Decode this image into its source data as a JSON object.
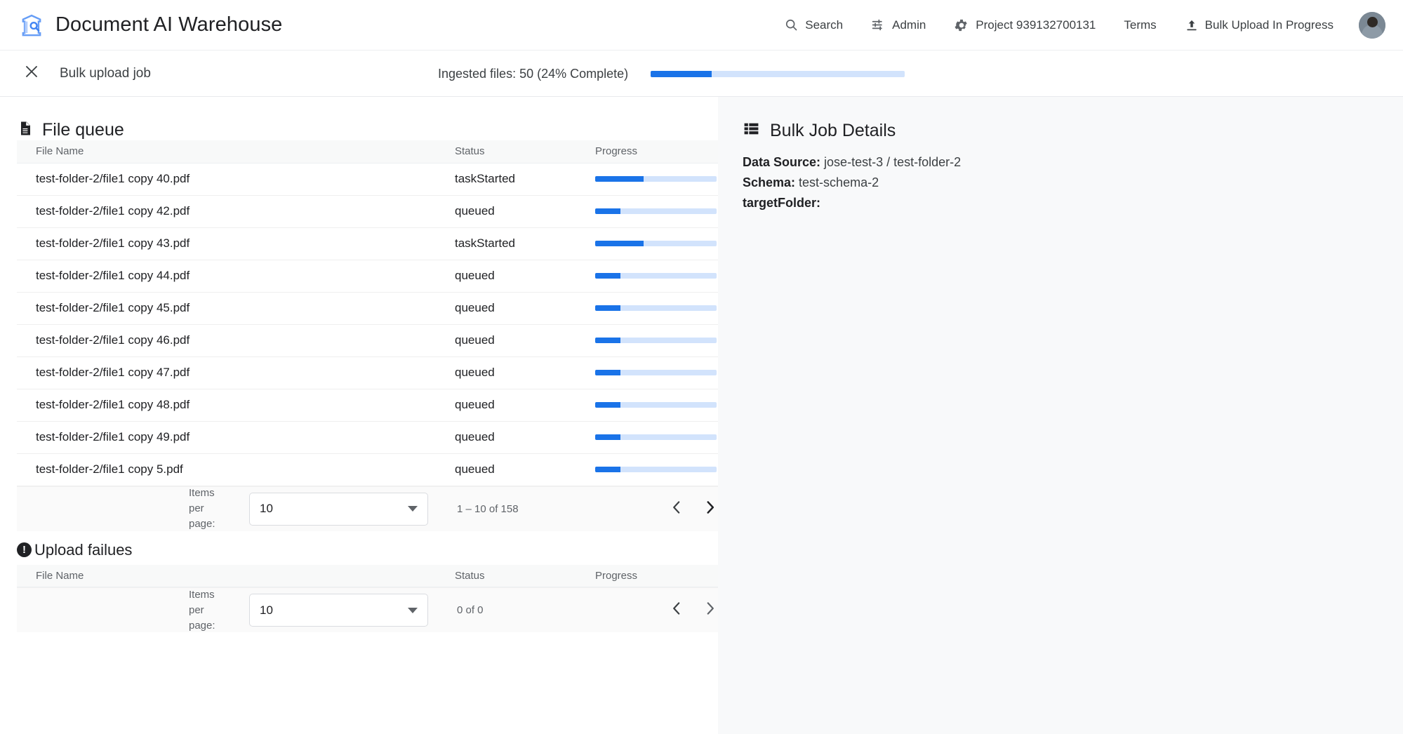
{
  "app": {
    "brand_title": "Document AI Warehouse",
    "brand_icon": "warehouse-search-icon",
    "nav": [
      {
        "label": "Search",
        "icon": "search-icon"
      },
      {
        "label": "Admin",
        "icon": "tune-icon"
      },
      {
        "label": "Project 939132700131",
        "icon": "gear-icon"
      },
      {
        "label": "Terms",
        "icon": "none"
      },
      {
        "label": "Bulk Upload In Progress",
        "icon": "upload-icon"
      }
    ],
    "avatar": "user-avatar"
  },
  "subbar": {
    "close_icon": "close-icon",
    "title": "Bulk upload job",
    "ingested_text": "Ingested files: 50 (24% Complete)",
    "progress_percent": 24
  },
  "file_queue": {
    "icon": "document-icon",
    "title": "File queue",
    "columns": [
      "File Name",
      "Status",
      "Progress"
    ],
    "rows": [
      {
        "name": "test-folder-2/file1 copy 40.pdf",
        "status": "taskStarted",
        "progress": 40
      },
      {
        "name": "test-folder-2/file1 copy 42.pdf",
        "status": "queued",
        "progress": 21
      },
      {
        "name": "test-folder-2/file1 copy 43.pdf",
        "status": "taskStarted",
        "progress": 40
      },
      {
        "name": "test-folder-2/file1 copy 44.pdf",
        "status": "queued",
        "progress": 21
      },
      {
        "name": "test-folder-2/file1 copy 45.pdf",
        "status": "queued",
        "progress": 21
      },
      {
        "name": "test-folder-2/file1 copy 46.pdf",
        "status": "queued",
        "progress": 21
      },
      {
        "name": "test-folder-2/file1 copy 47.pdf",
        "status": "queued",
        "progress": 21
      },
      {
        "name": "test-folder-2/file1 copy 48.pdf",
        "status": "queued",
        "progress": 21
      },
      {
        "name": "test-folder-2/file1 copy 49.pdf",
        "status": "queued",
        "progress": 21
      },
      {
        "name": "test-folder-2/file1 copy 5.pdf",
        "status": "queued",
        "progress": 21
      }
    ],
    "paginator": {
      "items_per_page_label": "Items per page:",
      "items_per_page_value": "10",
      "range_label": "1 – 10 of 158",
      "prev_icon": "chevron-left-icon",
      "next_icon": "chevron-right-icon"
    }
  },
  "upload_failures": {
    "icon": "error-icon",
    "title": "Upload failues",
    "columns": [
      "File Name",
      "Status",
      "Progress"
    ],
    "rows": [],
    "paginator": {
      "items_per_page_label": "Items per page:",
      "items_per_page_value": "10",
      "range_label": "0 of 0",
      "prev_icon": "chevron-left-icon",
      "next_icon": "chevron-right-icon"
    }
  },
  "bulk_job_details": {
    "icon": "list-icon",
    "title": "Bulk Job Details",
    "fields": [
      {
        "label": "Data Source:",
        "value": "jose-test-3 / test-folder-2"
      },
      {
        "label": "Schema:",
        "value": "test-schema-2"
      },
      {
        "label": "targetFolder:",
        "value": ""
      }
    ]
  },
  "colors": {
    "accent": "#1a73e8",
    "track": "#d2e3fc",
    "text_primary": "#202124",
    "text_secondary": "#5f6368",
    "panel_bg": "#f8f9fa"
  }
}
